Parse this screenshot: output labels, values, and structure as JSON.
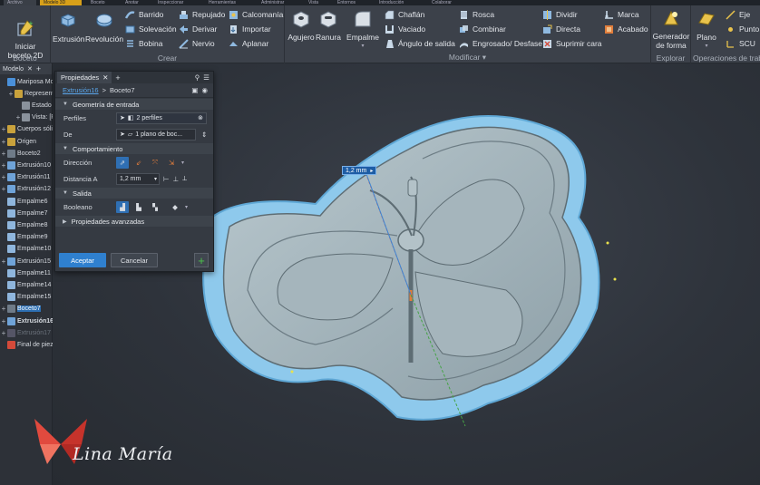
{
  "top_tabs": [
    "Archivo",
    "Modelo 3D",
    "Boceto",
    "Anotar",
    "Inspeccionar",
    "Herramientas",
    "Administrar",
    "Vista",
    "Entornos",
    "Introducción",
    "Colaborar"
  ],
  "ribbon": {
    "boceto": {
      "label": "Boceto",
      "start_sketch": "Iniciar\nboceto 2D"
    },
    "crear": {
      "label": "Crear",
      "extrusion": "Extrusión",
      "revolucion": "Revolución",
      "barrido": "Barrido",
      "solevacion": "Solevación",
      "bobina": "Bobina",
      "repujado": "Repujado",
      "derivar": "Derivar",
      "nervio": "Nervio",
      "calcomania": "Calcomanía",
      "importar": "Importar",
      "aplanar": "Aplanar"
    },
    "modificar": {
      "label": "Modificar",
      "agujero": "Agujero",
      "ranura": "Ranura",
      "empalme": "Empalme",
      "chaflan": "Chaflán",
      "vaciado": "Vaciado",
      "angulo_salida": "Ángulo de salida",
      "rosca": "Rosca",
      "combinar": "Combinar",
      "engrosado": "Engrosado/ Desfase",
      "dividir": "Dividir",
      "directa": "Directa",
      "suprimir_cara": "Suprimir cara",
      "marca": "Marca",
      "acabado": "Acabado"
    },
    "explorar": {
      "label": "Explorar",
      "generador": "Generador\nde forma"
    },
    "operaciones": {
      "label": "Operaciones de trabajo",
      "plano": "Plano",
      "eje": "Eje",
      "punto": "Punto",
      "scu": "SCU"
    }
  },
  "browser": {
    "tab": "Modelo",
    "rows": [
      {
        "label": "Mariposa Molde",
        "indent": 0,
        "plus": "",
        "color": "#4a90d9"
      },
      {
        "label": "Representaciones",
        "indent": 1,
        "plus": "+",
        "color": "#c9a23c"
      },
      {
        "label": "Estado",
        "indent": 2,
        "plus": "",
        "color": "#8a929c"
      },
      {
        "label": "Vista: [Principal]",
        "indent": 2,
        "plus": "+",
        "color": "#8a929c"
      },
      {
        "label": "Cuerpos sólidos",
        "indent": 0,
        "plus": "+",
        "color": "#c9a23c"
      },
      {
        "label": "Origen",
        "indent": 0,
        "plus": "+",
        "color": "#c9a23c"
      },
      {
        "label": "Boceto2",
        "indent": 0,
        "plus": "+",
        "color": "#6f7b88"
      },
      {
        "label": "Extrusión10",
        "indent": 0,
        "plus": "+",
        "color": "#6fa3d8"
      },
      {
        "label": "Extrusión11",
        "indent": 0,
        "plus": "+",
        "color": "#6fa3d8"
      },
      {
        "label": "Extrusión12",
        "indent": 0,
        "plus": "+",
        "color": "#6fa3d8"
      },
      {
        "label": "Empalme6",
        "indent": 0,
        "plus": "",
        "color": "#8fb6dd"
      },
      {
        "label": "Empalme7",
        "indent": 0,
        "plus": "",
        "color": "#8fb6dd"
      },
      {
        "label": "Empalme8",
        "indent": 0,
        "plus": "",
        "color": "#8fb6dd"
      },
      {
        "label": "Empalme9",
        "indent": 0,
        "plus": "",
        "color": "#8fb6dd"
      },
      {
        "label": "Empalme10",
        "indent": 0,
        "plus": "",
        "color": "#8fb6dd"
      },
      {
        "label": "Extrusión15",
        "indent": 0,
        "plus": "+",
        "color": "#6fa3d8"
      },
      {
        "label": "Empalme11",
        "indent": 0,
        "plus": "",
        "color": "#8fb6dd"
      },
      {
        "label": "Empalme14",
        "indent": 0,
        "plus": "",
        "color": "#8fb6dd"
      },
      {
        "label": "Empalme15",
        "indent": 0,
        "plus": "",
        "color": "#8fb6dd"
      },
      {
        "label": "Boceto7",
        "indent": 0,
        "plus": "+",
        "color": "#6f7b88",
        "selected": true
      },
      {
        "label": "Extrusión16",
        "indent": 0,
        "plus": "+",
        "color": "#6fa3d8",
        "bold": true
      },
      {
        "label": "Extrusión17",
        "indent": 0,
        "plus": "+",
        "color": "#556",
        "dim": true
      },
      {
        "label": "Final de pieza",
        "indent": 0,
        "plus": "",
        "color": "#d44a3a"
      }
    ]
  },
  "props": {
    "tab": "Propiedades",
    "breadcrumb_feature": "Extrusión16",
    "breadcrumb_sep": ">",
    "breadcrumb_sketch": "Boceto7",
    "sec_input": "Geometría de entrada",
    "perfiles_label": "Perfiles",
    "perfiles_value": "2 perfiles",
    "de_label": "De",
    "de_value": "1 plano de boc...",
    "sec_behavior": "Comportamiento",
    "direccion_label": "Dirección",
    "distancia_label": "Distancia A",
    "distancia_value": "1,2 mm",
    "sec_output": "Salida",
    "booleano_label": "Booleano",
    "sec_advanced": "Propiedades avanzadas",
    "accept": "Aceptar",
    "cancel": "Cancelar",
    "plus": "+"
  },
  "viewport": {
    "dimension": "1,2 mm"
  },
  "watermark": {
    "text": "Lina María"
  },
  "colors": {
    "accent": "#2f80cf",
    "part": "#a9b9c0",
    "highlight": "#8ec9ec",
    "active_tab": "#d8a019"
  }
}
